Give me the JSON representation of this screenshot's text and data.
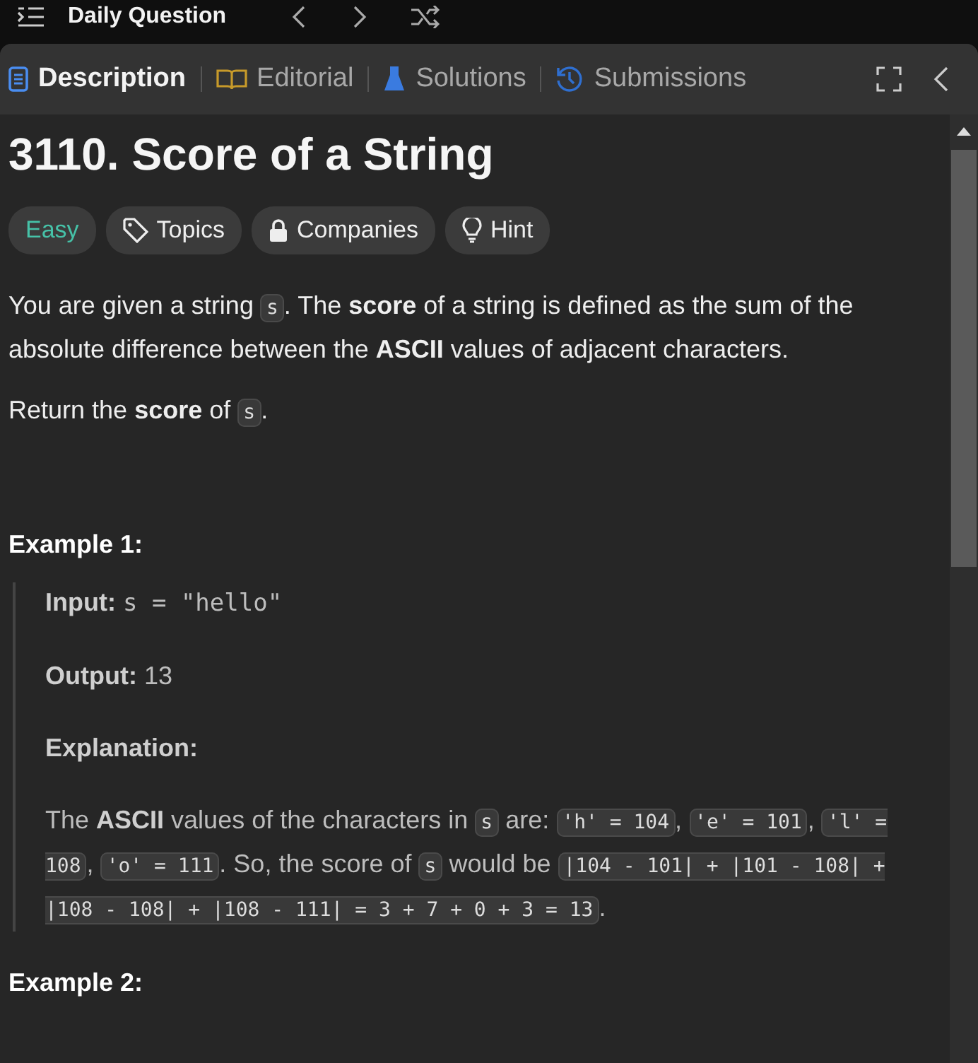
{
  "top_bar": {
    "title": "Daily Question"
  },
  "tabs": [
    {
      "label": "Description",
      "kind": "description",
      "selected": true
    },
    {
      "label": "Editorial",
      "kind": "editorial",
      "selected": false
    },
    {
      "label": "Solutions",
      "kind": "solutions",
      "selected": false
    },
    {
      "label": "Submissions",
      "kind": "submissions",
      "selected": false
    }
  ],
  "problem": {
    "title": "3110. Score of a String",
    "tags": [
      {
        "label": "Easy",
        "kind": "difficulty"
      },
      {
        "label": "Topics",
        "kind": "topics"
      },
      {
        "label": "Companies",
        "kind": "companies"
      },
      {
        "label": "Hint",
        "kind": "hint"
      }
    ],
    "paragraphs": [
      [
        {
          "kind": "text",
          "text": "You are given a string "
        },
        {
          "kind": "code",
          "text": "s"
        },
        {
          "kind": "text",
          "text": ". The "
        },
        {
          "kind": "bold",
          "text": "score"
        },
        {
          "kind": "text",
          "text": " of a string is defined as the sum of the absolute difference between the "
        },
        {
          "kind": "bold",
          "text": "ASCII"
        },
        {
          "kind": "text",
          "text": " values of adjacent characters."
        }
      ],
      [
        {
          "kind": "text",
          "text": "Return the "
        },
        {
          "kind": "bold",
          "text": "score"
        },
        {
          "kind": "text",
          "text": " of "
        },
        {
          "kind": "code",
          "text": "s"
        },
        {
          "kind": "text",
          "text": "."
        }
      ]
    ],
    "examples": [
      {
        "title": "Example 1:",
        "rows": [
          {
            "label": "Input:",
            "parts": [
              {
                "kind": "mono",
                "text": "s = \"hello\""
              }
            ]
          },
          {
            "label": "Output:",
            "parts": [
              {
                "kind": "text",
                "text": "13"
              }
            ]
          },
          {
            "label": "Explanation:",
            "parts": []
          },
          {
            "label": "",
            "parts": [
              {
                "kind": "text",
                "text": "The "
              },
              {
                "kind": "bold",
                "text": "ASCII"
              },
              {
                "kind": "text",
                "text": " values of the characters in "
              },
              {
                "kind": "code",
                "text": "s"
              },
              {
                "kind": "text",
                "text": " are: "
              },
              {
                "kind": "code",
                "text": "'h' = 104"
              },
              {
                "kind": "text",
                "text": ", "
              },
              {
                "kind": "code",
                "text": "'e' = 101"
              },
              {
                "kind": "text",
                "text": ", "
              },
              {
                "kind": "code",
                "text": "'l' = 108"
              },
              {
                "kind": "text",
                "text": ", "
              },
              {
                "kind": "code",
                "text": "'o' = 111"
              },
              {
                "kind": "text",
                "text": ". So, the score of "
              },
              {
                "kind": "code",
                "text": "s"
              },
              {
                "kind": "text",
                "text": " would be "
              },
              {
                "kind": "code",
                "text": "|104 - 101| + |101 - 108| + |108 - 108| + |108 - 111| = 3 + 7 + 0 + 3 = 13"
              },
              {
                "kind": "text",
                "text": "."
              }
            ]
          }
        ]
      },
      {
        "title": "Example 2:"
      }
    ]
  }
}
